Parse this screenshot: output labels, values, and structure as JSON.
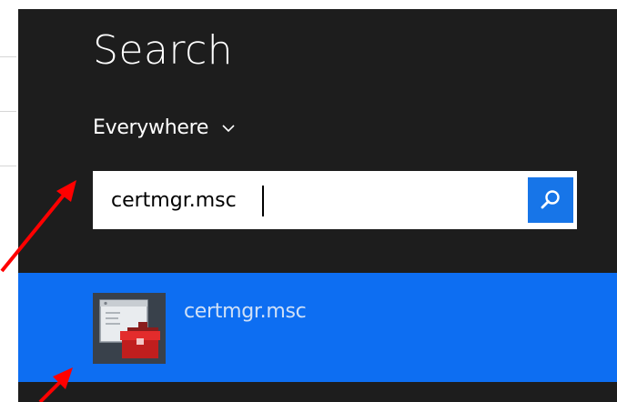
{
  "search_pane": {
    "title": "Search",
    "scope_label": "Everywhere",
    "query_value": "certmgr.msc"
  },
  "results": [
    {
      "label": "certmgr.msc",
      "icon": "toolbox-window-icon",
      "selected": true
    }
  ],
  "colors": {
    "pane_background": "#1d1d1d",
    "accent": "#1775e8",
    "result_highlight": "#0d6ef2",
    "annotation_arrow": "#ff0000"
  }
}
